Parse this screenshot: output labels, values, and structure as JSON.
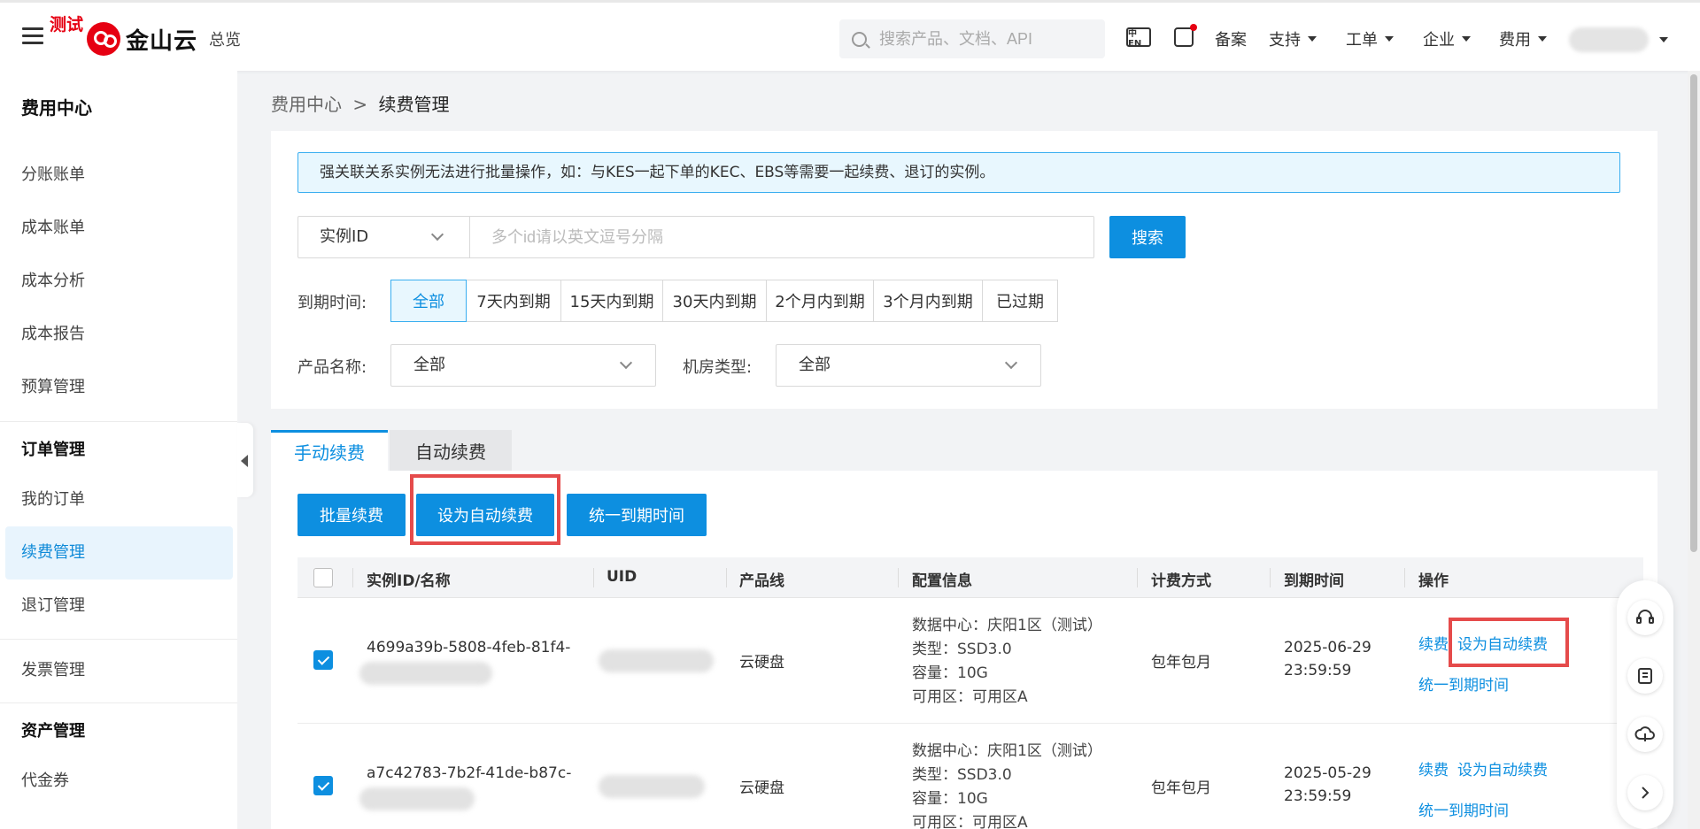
{
  "header": {
    "test_badge": "测试",
    "logo_text": "金山云",
    "overview": "总览",
    "search_placeholder": "搜索产品、文档、API",
    "lang_icon": "中EN",
    "nav": [
      "备案",
      "支持",
      "工单",
      "企业",
      "费用"
    ]
  },
  "sidebar": {
    "title": "费用中心",
    "items_billing": [
      "分账账单",
      "成本账单",
      "成本分析",
      "成本报告",
      "预算管理"
    ],
    "group_order": "订单管理",
    "items_order": [
      "我的订单",
      "续费管理",
      "退订管理"
    ],
    "invoice": "发票管理",
    "group_assets": "资产管理",
    "items_assets": [
      "代金券"
    ]
  },
  "breadcrumb": {
    "parent": "费用中心",
    "sep": ">",
    "current": "续费管理"
  },
  "filters": {
    "notice": "强关联关系实例无法进行批量操作，如：与KES一起下单的KEC、EBS等需要一起续费、退订的实例。",
    "id_type": "实例ID",
    "id_placeholder": "多个id请以英文逗号分隔",
    "search_button": "搜索",
    "expire_label": "到期时间:",
    "expire_options": [
      "全部",
      "7天内到期",
      "15天内到期",
      "30天内到期",
      "2个月内到期",
      "3个月内到期",
      "已过期"
    ],
    "product_label": "产品名称:",
    "product_value": "全部",
    "room_label": "机房类型:",
    "room_value": "全部"
  },
  "tabs": [
    "手动续费",
    "自动续费"
  ],
  "actions": [
    "批量续费",
    "设为自动续费",
    "统一到期时间"
  ],
  "table": {
    "headers": [
      "实例ID/名称",
      "UID",
      "产品线",
      "配置信息",
      "计费方式",
      "到期时间",
      "操作"
    ],
    "rows": [
      {
        "id": "4699a39b-5808-4feb-81f4-",
        "product": "云硬盘",
        "config": [
          "数据中心：庆阳1区（测试）",
          "类型：SSD3.0",
          "容量：10G",
          "可用区：可用区A"
        ],
        "billing": "包年包月",
        "expire_date": "2025-06-29",
        "expire_time": "23:59:59",
        "op_renew": "续费",
        "op_auto": "设为自动续费",
        "op_unify": "统一到期时间"
      },
      {
        "id": "a7c42783-7b2f-41de-b87c-",
        "product": "云硬盘",
        "config": [
          "数据中心：庆阳1区（测试）",
          "类型：SSD3.0",
          "容量：10G",
          "可用区：可用区A"
        ],
        "billing": "包年包月",
        "expire_date": "2025-05-29",
        "expire_time": "23:59:59",
        "op_renew": "续费",
        "op_auto": "设为自动续费",
        "op_unify": "统一到期时间"
      }
    ]
  },
  "float_tools": [
    "headset-icon",
    "document-icon",
    "cloud-icon",
    "chevron-right-icon"
  ],
  "colors": {
    "primary": "#0d8fe0",
    "highlight": "#e54b4b",
    "brand": "#e60012"
  }
}
